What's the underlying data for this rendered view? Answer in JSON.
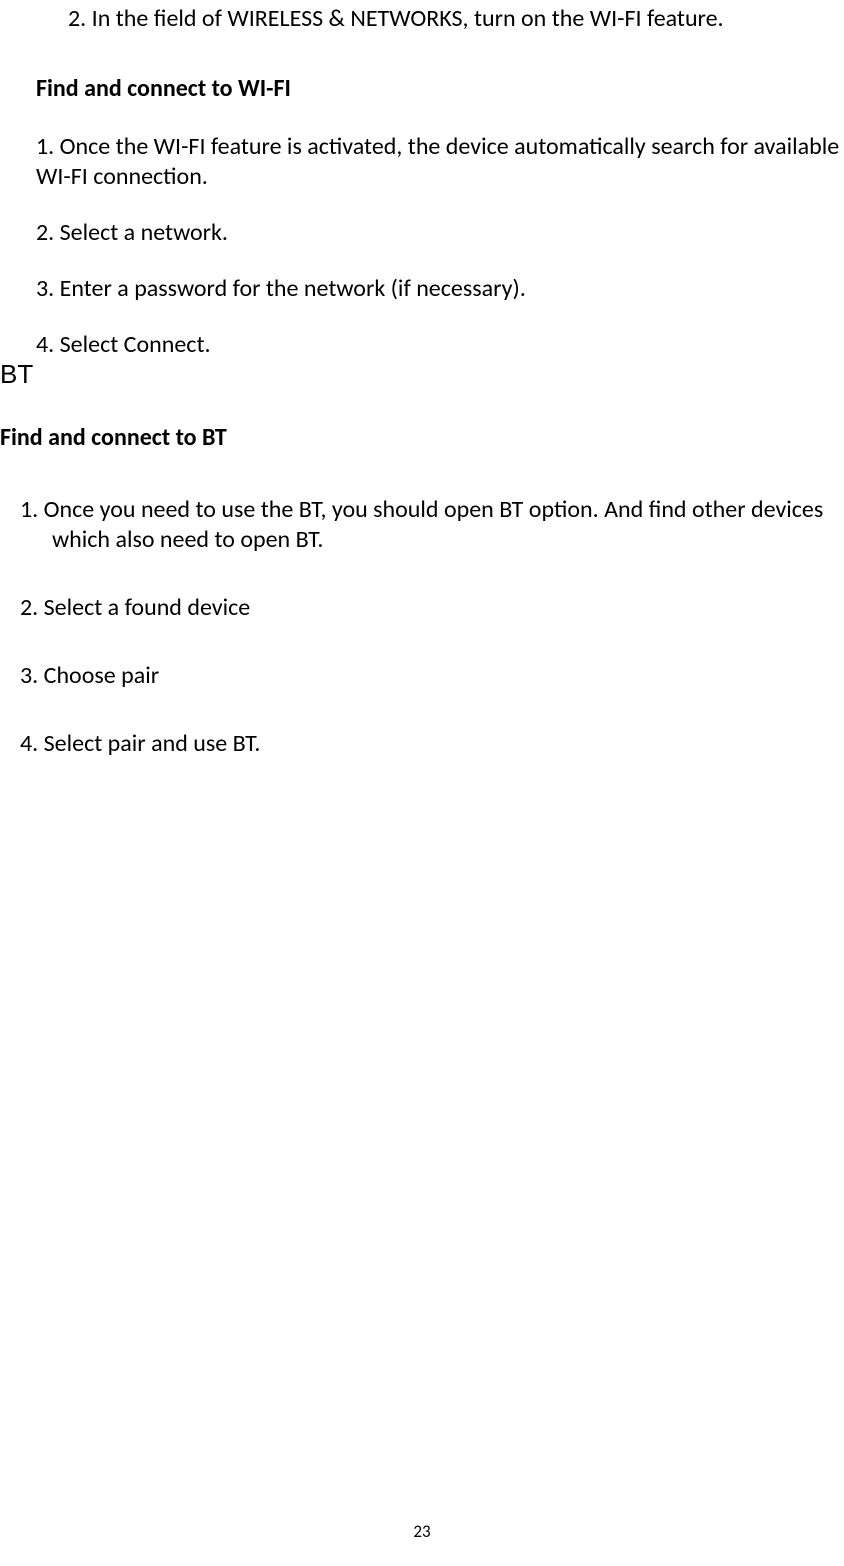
{
  "line1": "2. In the field of WIRELESS & NETWORKS, turn on the WI-FI feature.",
  "heading1": "Find and connect to WI-FI",
  "wifi_step1": "1. Once the WI-FI feature is activated, the device automatically search for available WI-FI connection.",
  "wifi_step2": "2. Select a network.",
  "wifi_step3": "3. Enter a password for the network (if necessary).",
  "wifi_step4": "4. Select Connect.",
  "section_bt": "BT",
  "heading2": "Find and connect to BT",
  "bt_step1": "1. Once you need to use the BT, you should open BT option. And find other devices which also need to open BT.",
  "bt_step2": "2. Select a found device",
  "bt_step3": "3. Choose pair",
  "bt_step4": "4. Select pair and use BT.",
  "page_number": "23"
}
